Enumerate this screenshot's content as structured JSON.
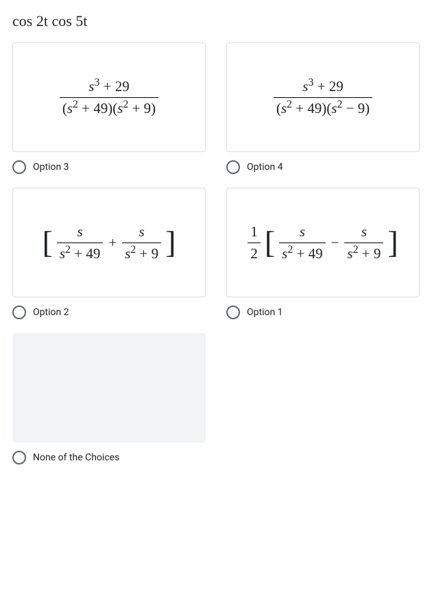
{
  "question": "cos 2t cos 5t",
  "options": {
    "opt3": {
      "label": "Option 3",
      "math": {
        "num": "s³ + 29",
        "den": "(s² + 49)(s² + 9)"
      }
    },
    "opt4": {
      "label": "Option 4",
      "math": {
        "num": "s³ + 29",
        "den": "(s² + 49)(s² − 9)"
      }
    },
    "opt2": {
      "label": "Option 2",
      "math": {
        "lead": "",
        "t1": {
          "num": "s",
          "den": "s² + 49"
        },
        "op": "+",
        "t2": {
          "num": "s",
          "den": "s² + 9"
        }
      }
    },
    "opt1": {
      "label": "Option 1",
      "math": {
        "lead_num": "1",
        "lead_den": "2",
        "t1": {
          "num": "s",
          "den": "s² + 49"
        },
        "op": "−",
        "t2": {
          "num": "s",
          "den": "s² + 9"
        }
      }
    },
    "none": {
      "label": "None of the Choices"
    }
  }
}
